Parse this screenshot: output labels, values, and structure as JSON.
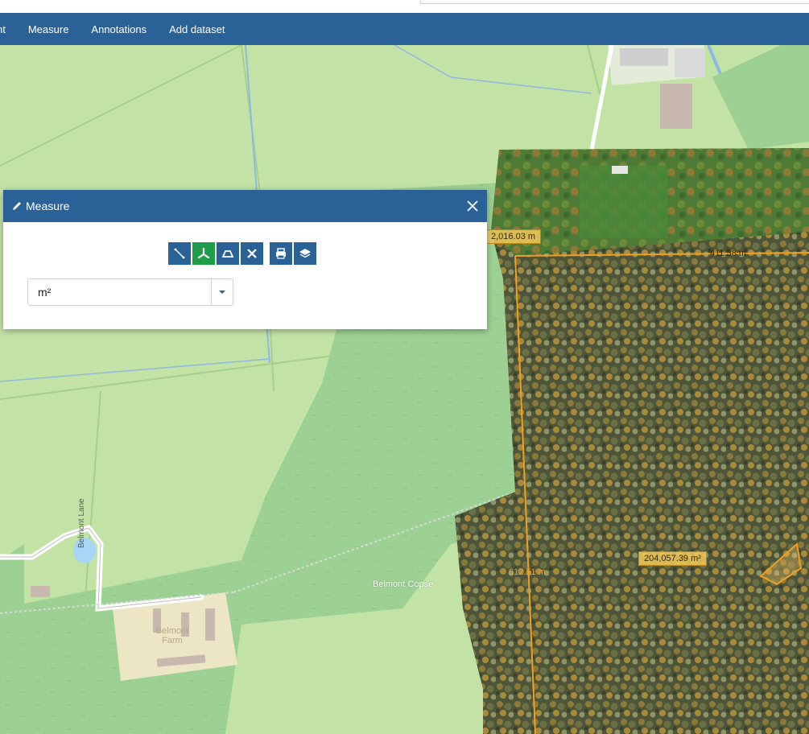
{
  "nav": {
    "items": [
      {
        "label": "nt"
      },
      {
        "label": "Measure"
      },
      {
        "label": "Annotations"
      },
      {
        "label": "Add dataset"
      }
    ]
  },
  "panel": {
    "title": "Measure",
    "tools": [
      {
        "icon": "line-measure-icon"
      },
      {
        "icon": "area-measure-icon",
        "active": true
      },
      {
        "icon": "angle-measure-icon"
      },
      {
        "icon": "clear-icon"
      },
      {
        "icon": "print-icon"
      },
      {
        "icon": "layers-icon"
      }
    ],
    "unit": {
      "value": "m²"
    }
  },
  "map": {
    "labels": {
      "perimeter": "2,016.03 m",
      "top_edge": "411.38 m",
      "left_edge": "612.51 m",
      "area": "204,057.39 m²",
      "belmont_lane": "Belmont Lane",
      "belmont_copse": "Belmont Copse",
      "belmont_farm": "Belmont Farm"
    }
  },
  "colors": {
    "nav_bg": "#2a6298",
    "active_tool": "#1f9e4a",
    "measure_line": "#f0a020"
  }
}
